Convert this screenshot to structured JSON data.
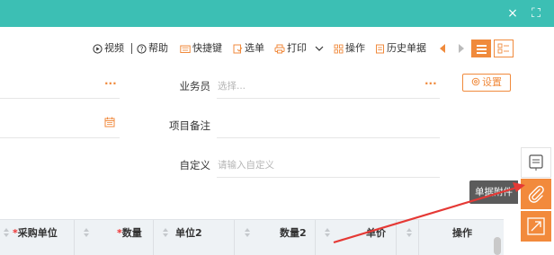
{
  "window": {
    "close_icon": "×",
    "fullscreen_icon": "⛶",
    "bar_color": "#3cbfb4"
  },
  "toolbar": {
    "video": "视频",
    "help": "帮助",
    "shortcut": "快捷键",
    "select": "选单",
    "print": "打印",
    "operate": "操作",
    "history": "历史单据"
  },
  "form": {
    "salesman_label": "业务员",
    "salesman_placeholder": "选择...",
    "remark_label": "项目备注",
    "custom_label": "自定义",
    "custom_placeholder": "请输入自定义",
    "settings": "设置",
    "more_dots": "···"
  },
  "side": {
    "attachment_tooltip": "单据附件"
  },
  "table": {
    "columns": [
      {
        "label": "采购单位",
        "required": true
      },
      {
        "label": "数量",
        "required": true
      },
      {
        "label": "单位2",
        "required": false
      },
      {
        "label": "数量2",
        "required": false
      },
      {
        "label": "单价",
        "required": false
      },
      {
        "label": "操作",
        "required": false
      }
    ]
  },
  "colors": {
    "accent": "#f08a3c",
    "teal": "#3cbfb4",
    "arrow": "#e53935"
  }
}
